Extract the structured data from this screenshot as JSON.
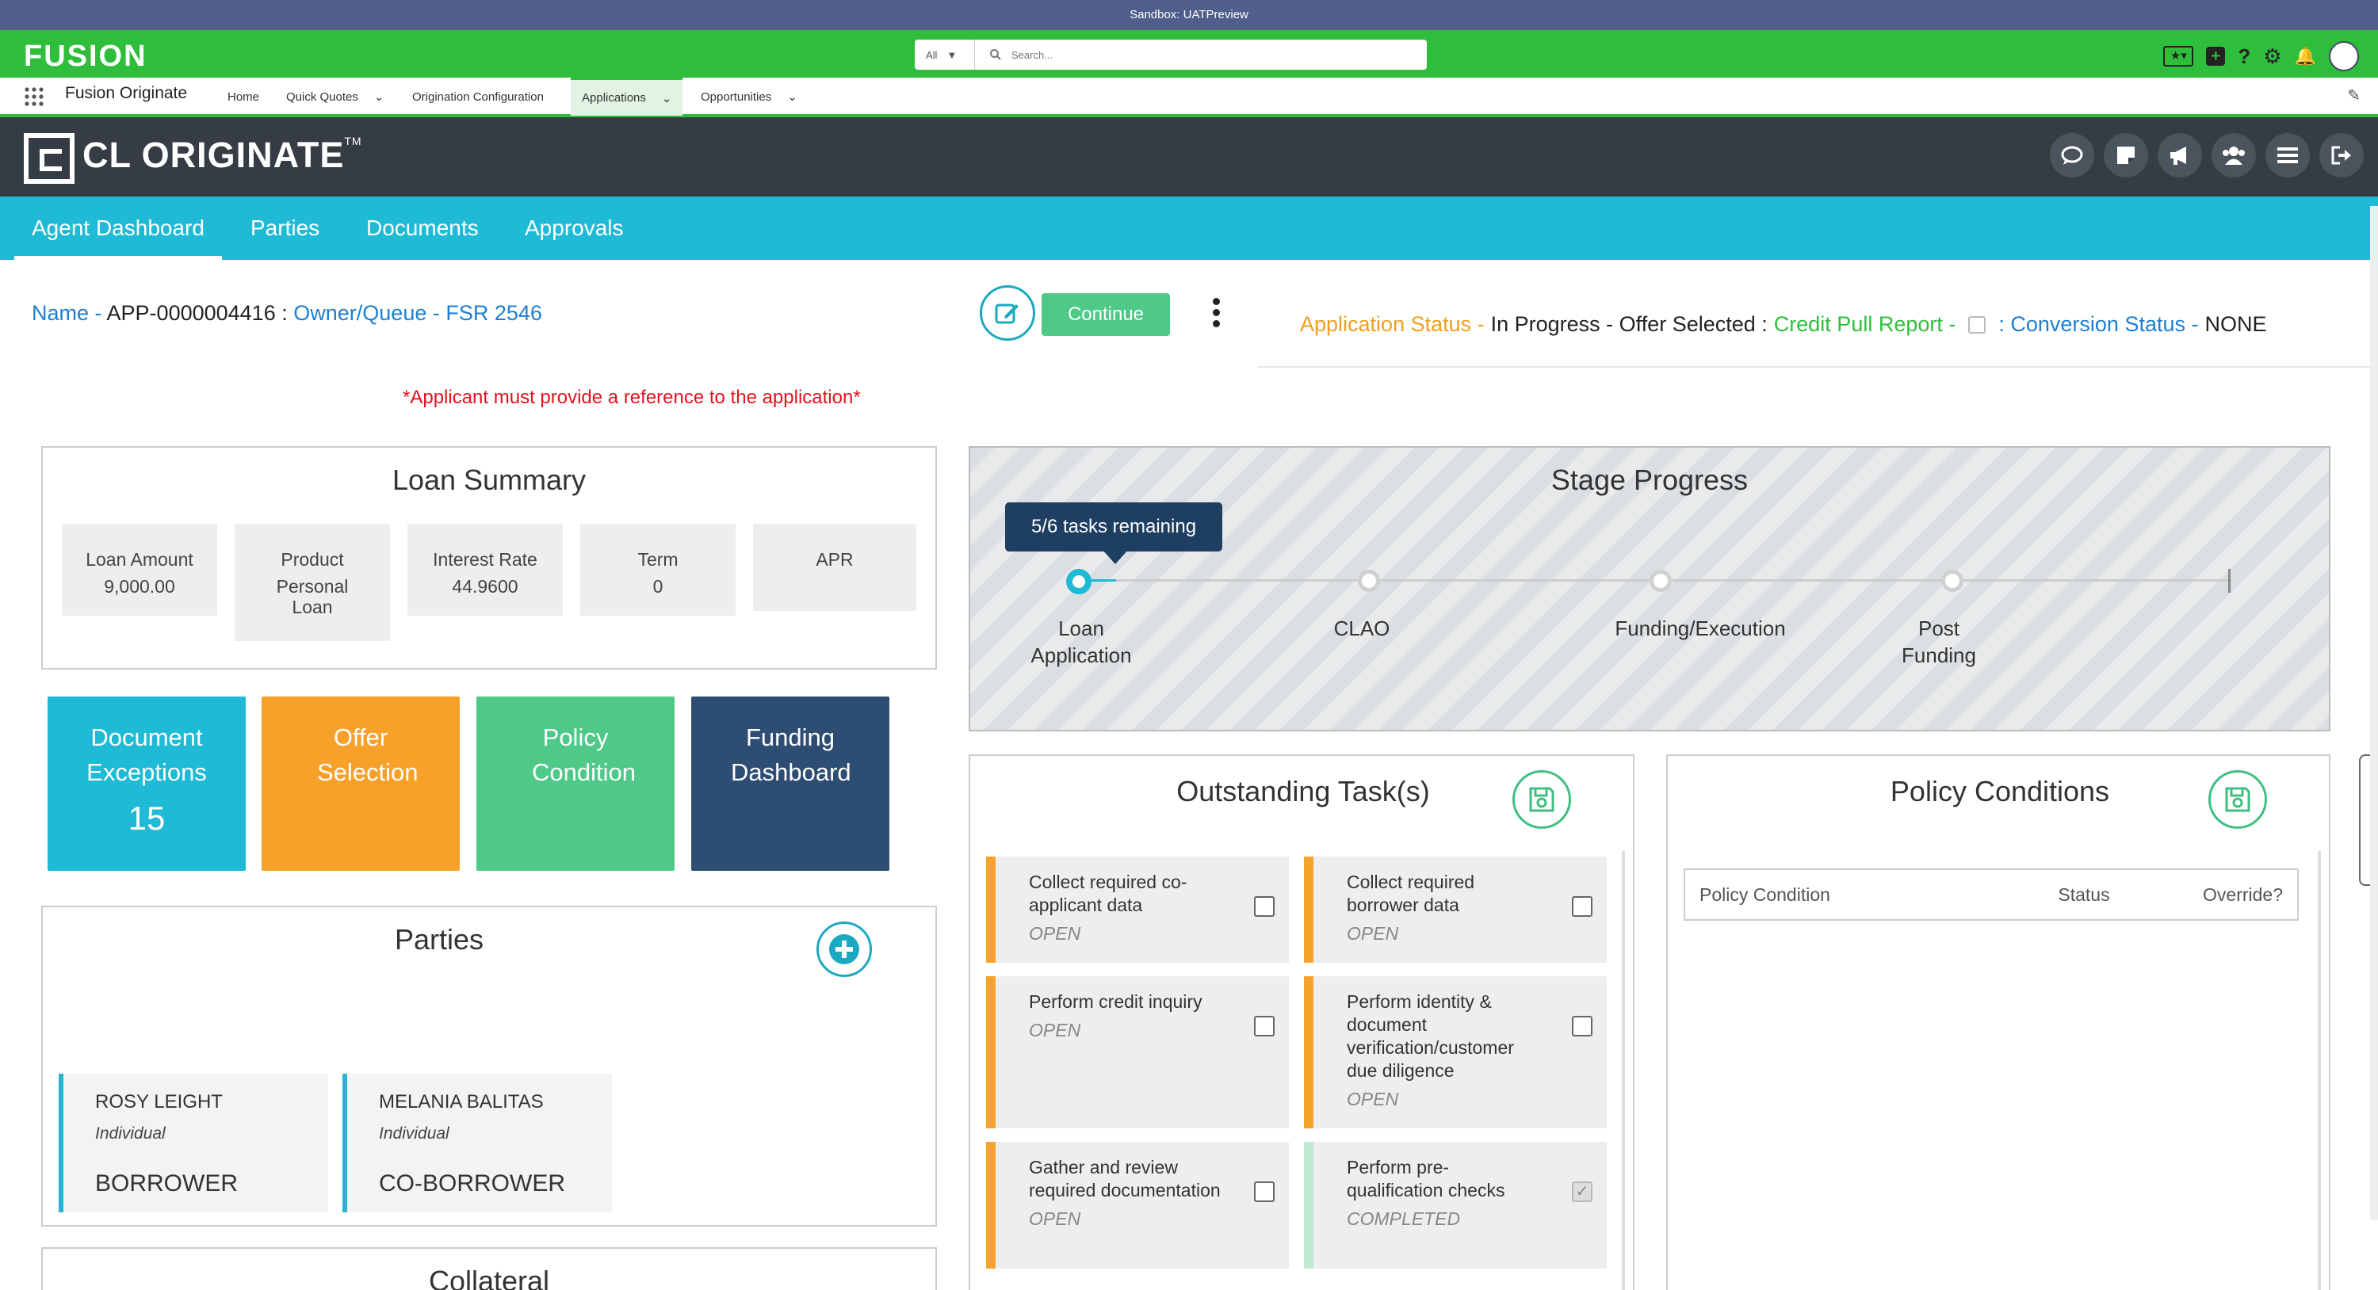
{
  "sandbox_label": "Sandbox: UATPreview",
  "brand": {
    "logo_text": "FUSION",
    "app_name": "Fusion Originate",
    "cl_title": "CL ORIGINATE",
    "cl_tm": "TM"
  },
  "search": {
    "scope": "All",
    "placeholder": "Search..."
  },
  "nav": [
    {
      "label": "Home",
      "dropdown": false
    },
    {
      "label": "Quick Quotes",
      "dropdown": true
    },
    {
      "label": "Origination Configuration",
      "dropdown": false
    },
    {
      "label": "Applications",
      "dropdown": true,
      "active": true
    },
    {
      "label": "Opportunities",
      "dropdown": true
    }
  ],
  "tabs": [
    "Agent Dashboard",
    "Parties",
    "Documents",
    "Approvals"
  ],
  "app_header": {
    "name_label": "Name -",
    "name_value": "APP-0000004416",
    "sep": ":",
    "owner_label": "Owner/Queue -",
    "owner_value": "FSR 2546",
    "continue_label": "Continue",
    "status_label": "Application Status -",
    "status_value": "In Progress - Offer Selected :",
    "credit_label": "Credit Pull Report -",
    "conversion_label": ": Conversion Status -",
    "conversion_value": "NONE"
  },
  "warning": "*Applicant must provide a reference to the application*",
  "loan_summary": {
    "title": "Loan Summary",
    "items": [
      {
        "label": "Loan Amount",
        "value": "9,000.00"
      },
      {
        "label": "Product",
        "value": "Personal Loan"
      },
      {
        "label": "Interest Rate",
        "value": "44.9600"
      },
      {
        "label": "Term",
        "value": "0"
      },
      {
        "label": "APR",
        "value": ""
      }
    ]
  },
  "tiles": [
    {
      "label": "Document Exceptions",
      "count": "15",
      "color": "#1fbad6"
    },
    {
      "label": "Offer Selection",
      "count": "",
      "color": "#f7a12a"
    },
    {
      "label": "Policy Condition",
      "count": "",
      "color": "#4ec988"
    },
    {
      "label": "Funding Dashboard",
      "count": "",
      "color": "#2d4d72"
    }
  ],
  "parties": {
    "title": "Parties",
    "list": [
      {
        "name": "ROSY LEIGHT",
        "type": "Individual",
        "role": "BORROWER"
      },
      {
        "name": "MELANIA BALITAS",
        "type": "Individual",
        "role": "CO-BORROWER"
      }
    ]
  },
  "collateral_title": "Collateral",
  "stage_progress": {
    "title": "Stage Progress",
    "tooltip": "5/6 tasks remaining",
    "stages": [
      "Loan Application",
      "CLAO",
      "Funding/Execution",
      "Post Funding"
    ]
  },
  "outstanding_tasks": {
    "title": "Outstanding Task(s)",
    "tasks": [
      {
        "title": "Collect required co-applicant data",
        "status": "OPEN",
        "checked": false
      },
      {
        "title": "Collect required borrower data",
        "status": "OPEN",
        "checked": false
      },
      {
        "title": "Perform credit inquiry",
        "status": "OPEN",
        "checked": false
      },
      {
        "title": "Perform identity & document verification/customer due diligence",
        "status": "OPEN",
        "checked": false
      },
      {
        "title": "Gather and review required documentation",
        "status": "OPEN",
        "checked": false
      },
      {
        "title": "Perform pre-qualification checks",
        "status": "COMPLETED",
        "checked": true
      }
    ]
  },
  "policy_conditions": {
    "title": "Policy Conditions",
    "columns": [
      "Policy Condition",
      "Status",
      "Override?"
    ]
  },
  "colors": {
    "green": "#2fbe3c",
    "teal": "#1fbad6",
    "dark_header": "#363c44",
    "orange": "#f7a12a"
  }
}
